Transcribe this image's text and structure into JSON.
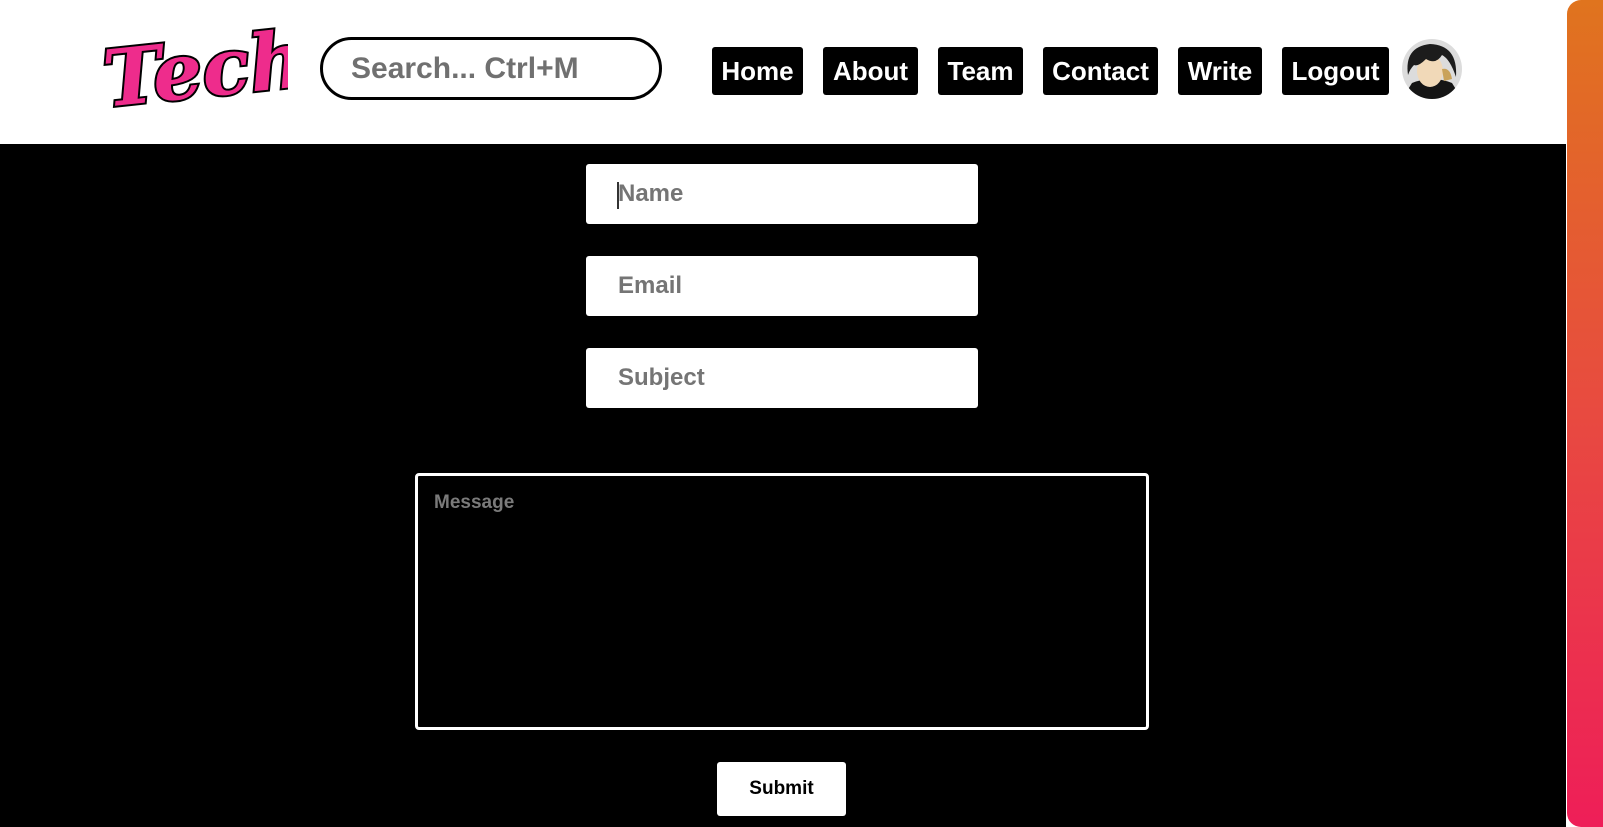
{
  "header": {
    "logo_text": "Techy",
    "search": {
      "placeholder": "Search... Ctrl+M",
      "value": ""
    },
    "nav": [
      {
        "label": "Home"
      },
      {
        "label": "About"
      },
      {
        "label": "Team"
      },
      {
        "label": "Contact"
      },
      {
        "label": "Write"
      },
      {
        "label": "Logout"
      }
    ]
  },
  "contact_form": {
    "name": {
      "placeholder": "Name",
      "value": ""
    },
    "email": {
      "placeholder": "Email",
      "value": ""
    },
    "subject": {
      "placeholder": "Subject",
      "value": ""
    },
    "message": {
      "placeholder": "Message",
      "value": ""
    },
    "submit_label": "Submit"
  },
  "colors": {
    "logo_pink": "#ee2c8c",
    "page_background": "#000000",
    "header_background": "#ffffff",
    "nav_button_background": "#000000",
    "scrollbar_gradient_top": "#e0741e",
    "scrollbar_gradient_bottom": "#ee1e58"
  },
  "icons": {
    "avatar": "user-avatar-anime-character"
  }
}
